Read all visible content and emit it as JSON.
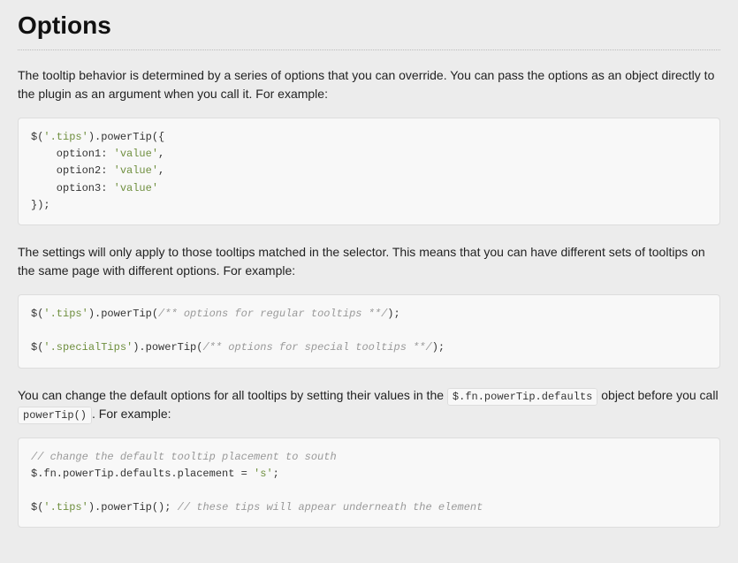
{
  "heading": "Options",
  "para1": "The tooltip behavior is determined by a series of options that you can override. You can pass the options as an object directly to the plugin as an argument when you call it. For example:",
  "para2": "The settings will only apply to those tooltips matched in the selector. This means that you can have different sets of tooltips on the same page with different options. For example:",
  "para3a": "You can change the default options for all tooltips by setting their values in the ",
  "para3b": " object before you call ",
  "para3c": ". For example:",
  "inline1": "$.fn.powerTip.defaults",
  "inline2": "powerTip()",
  "code1": {
    "l1a": "$(",
    "l1b": "'.tips'",
    "l1c": ").powerTip({",
    "l2a": "    option1",
    "l2b": ": ",
    "l2c": "'value'",
    "l2d": ",",
    "l3a": "    option2",
    "l3b": ": ",
    "l3c": "'value'",
    "l3d": ",",
    "l4a": "    option3",
    "l4b": ": ",
    "l4c": "'value'",
    "l5": "});"
  },
  "code2": {
    "l1a": "$(",
    "l1b": "'.tips'",
    "l1c": ").powerTip(",
    "l1d": "/** options for regular tooltips **/",
    "l1e": ");",
    "l2a": "$(",
    "l2b": "'.specialTips'",
    "l2c": ").powerTip(",
    "l2d": "/** options for special tooltips **/",
    "l2e": ");"
  },
  "code3": {
    "l1": "// change the default tooltip placement to south",
    "l2a": "$.fn.powerTip.defaults.placement = ",
    "l2b": "'s'",
    "l2c": ";",
    "l3a": "$(",
    "l3b": "'.tips'",
    "l3c": ").powerTip(); ",
    "l3d": "// these tips will appear underneath the element"
  }
}
